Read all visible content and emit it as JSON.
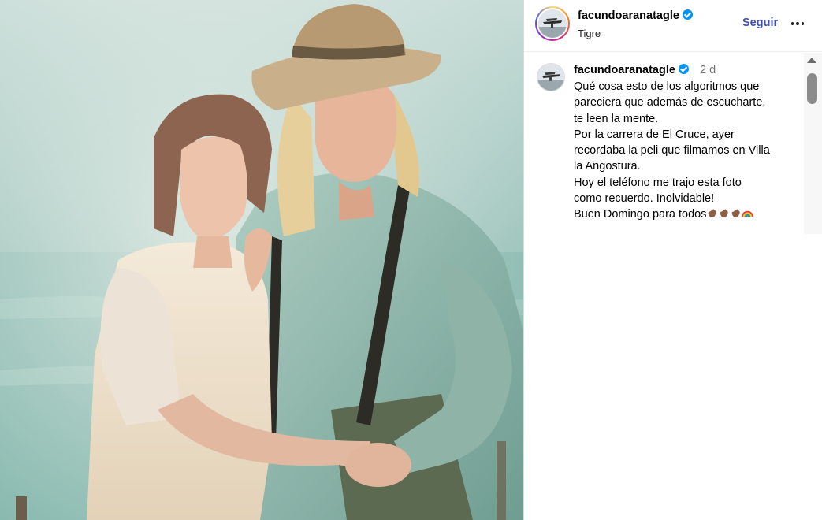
{
  "post": {
    "image_description_icon": "photo-icon",
    "header": {
      "username": "facundoaranatagle",
      "location": "Tigre",
      "follow_label": "Seguir",
      "more_icon": "more-horizontal-icon"
    },
    "caption": {
      "username": "facundoaranatagle",
      "time": "2 d",
      "lines": [
        "Qué cosa esto de los algoritmos que",
        "pareciera que además de escucharte,",
        "te leen la mente.",
        " Por la carrera de El Cruce, ayer",
        "recordaba la peli que filmamos en Villa",
        "la Angostura.",
        " Hoy el teléfono me trajo esta foto",
        "como recuerdo. Inolvidable!",
        " Buen Domingo para todos"
      ],
      "trailing_emoji": [
        "hand-icon",
        "hand-icon",
        "hand-icon",
        "rainbow-icon"
      ]
    }
  },
  "colors": {
    "follow": "#3f51b5",
    "verified": "#0095f6",
    "muted_text": "#737373"
  }
}
